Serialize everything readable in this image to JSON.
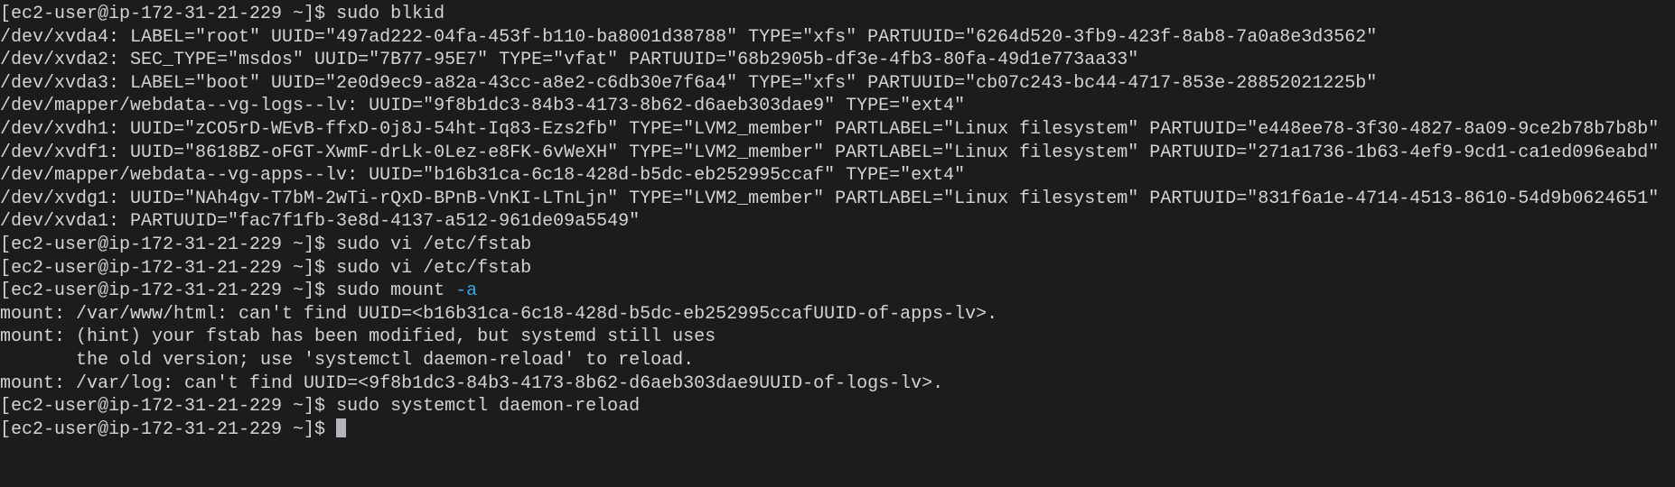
{
  "terminal": {
    "prompt": "[ec2-user@ip-172-31-21-229 ~]$ ",
    "lines": [
      {
        "type": "cmd",
        "text": "sudo blkid"
      },
      {
        "type": "out",
        "text": "/dev/xvda4: LABEL=\"root\" UUID=\"497ad222-04fa-453f-b110-ba8001d38788\" TYPE=\"xfs\" PARTUUID=\"6264d520-3fb9-423f-8ab8-7a0a8e3d3562\""
      },
      {
        "type": "out",
        "text": "/dev/xvda2: SEC_TYPE=\"msdos\" UUID=\"7B77-95E7\" TYPE=\"vfat\" PARTUUID=\"68b2905b-df3e-4fb3-80fa-49d1e773aa33\""
      },
      {
        "type": "out",
        "text": "/dev/xvda3: LABEL=\"boot\" UUID=\"2e0d9ec9-a82a-43cc-a8e2-c6db30e7f6a4\" TYPE=\"xfs\" PARTUUID=\"cb07c243-bc44-4717-853e-28852021225b\""
      },
      {
        "type": "out",
        "text": "/dev/mapper/webdata--vg-logs--lv: UUID=\"9f8b1dc3-84b3-4173-8b62-d6aeb303dae9\" TYPE=\"ext4\""
      },
      {
        "type": "out",
        "text": "/dev/xvdh1: UUID=\"zCO5rD-WEvB-ffxD-0j8J-54ht-Iq83-Ezs2fb\" TYPE=\"LVM2_member\" PARTLABEL=\"Linux filesystem\" PARTUUID=\"e448ee78-3f30-4827-8a09-9ce2b78b7b8b\""
      },
      {
        "type": "out",
        "text": "/dev/xvdf1: UUID=\"8618BZ-oFGT-XwmF-drLk-0Lez-e8FK-6vWeXH\" TYPE=\"LVM2_member\" PARTLABEL=\"Linux filesystem\" PARTUUID=\"271a1736-1b63-4ef9-9cd1-ca1ed096eabd\""
      },
      {
        "type": "out",
        "text": "/dev/mapper/webdata--vg-apps--lv: UUID=\"b16b31ca-6c18-428d-b5dc-eb252995ccaf\" TYPE=\"ext4\""
      },
      {
        "type": "out",
        "text": "/dev/xvdg1: UUID=\"NAh4gv-T7bM-2wTi-rQxD-BPnB-VnKI-LTnLjn\" TYPE=\"LVM2_member\" PARTLABEL=\"Linux filesystem\" PARTUUID=\"831f6a1e-4714-4513-8610-54d9b0624651\""
      },
      {
        "type": "out",
        "text": "/dev/xvda1: PARTUUID=\"fac7f1fb-3e8d-4137-a512-961de09a5549\""
      },
      {
        "type": "cmd",
        "text": "sudo vi /etc/fstab"
      },
      {
        "type": "cmd",
        "text": "sudo vi /etc/fstab"
      },
      {
        "type": "cmd",
        "text": "sudo mount ",
        "flag": "-a"
      },
      {
        "type": "out",
        "text": "mount: /var/www/html: can't find UUID=<b16b31ca-6c18-428d-b5dc-eb252995ccafUUID-of-apps-lv>."
      },
      {
        "type": "out",
        "text": "mount: (hint) your fstab has been modified, but systemd still uses"
      },
      {
        "type": "out",
        "text": "       the old version; use 'systemctl daemon-reload' to reload."
      },
      {
        "type": "out",
        "text": "mount: /var/log: can't find UUID=<9f8b1dc3-84b3-4173-8b62-d6aeb303dae9UUID-of-logs-lv>."
      },
      {
        "type": "cmd",
        "text": "sudo systemctl daemon-reload"
      },
      {
        "type": "cmd",
        "text": "",
        "cursor": true
      }
    ]
  },
  "colors": {
    "background": "#1c1c1c",
    "text": "#d4d4d4",
    "flag": "#3ba7e6",
    "cursor": "#b4b4bc"
  }
}
